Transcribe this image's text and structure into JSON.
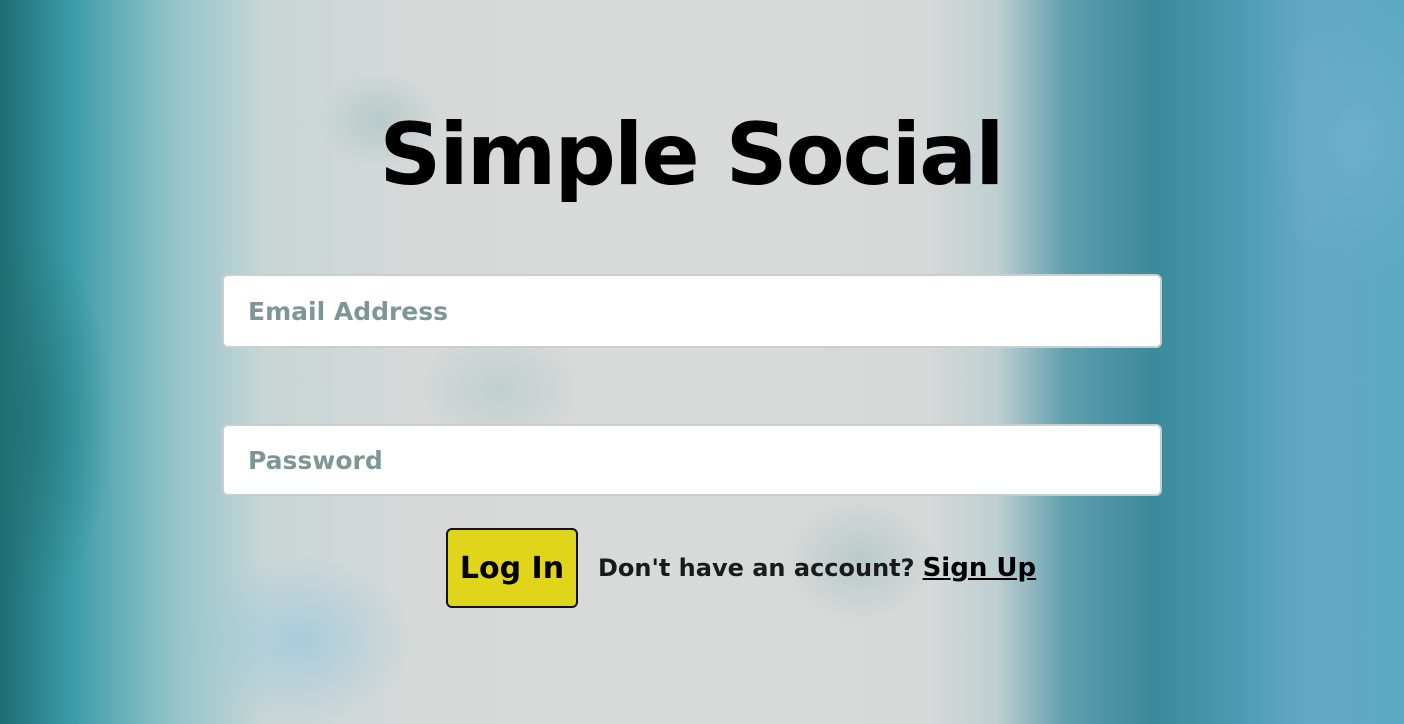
{
  "app": {
    "title": "Simple Social"
  },
  "login_form": {
    "email": {
      "placeholder": "Email Address",
      "value": ""
    },
    "password": {
      "placeholder": "Password",
      "value": ""
    },
    "login_button_label": "Log In",
    "signup_prompt": "Don't have an account?",
    "signup_link_label": "Sign Up"
  },
  "colors": {
    "login_button": "#e1d51b",
    "placeholder_text": "#7f9696",
    "field_background": "#ffffff"
  }
}
